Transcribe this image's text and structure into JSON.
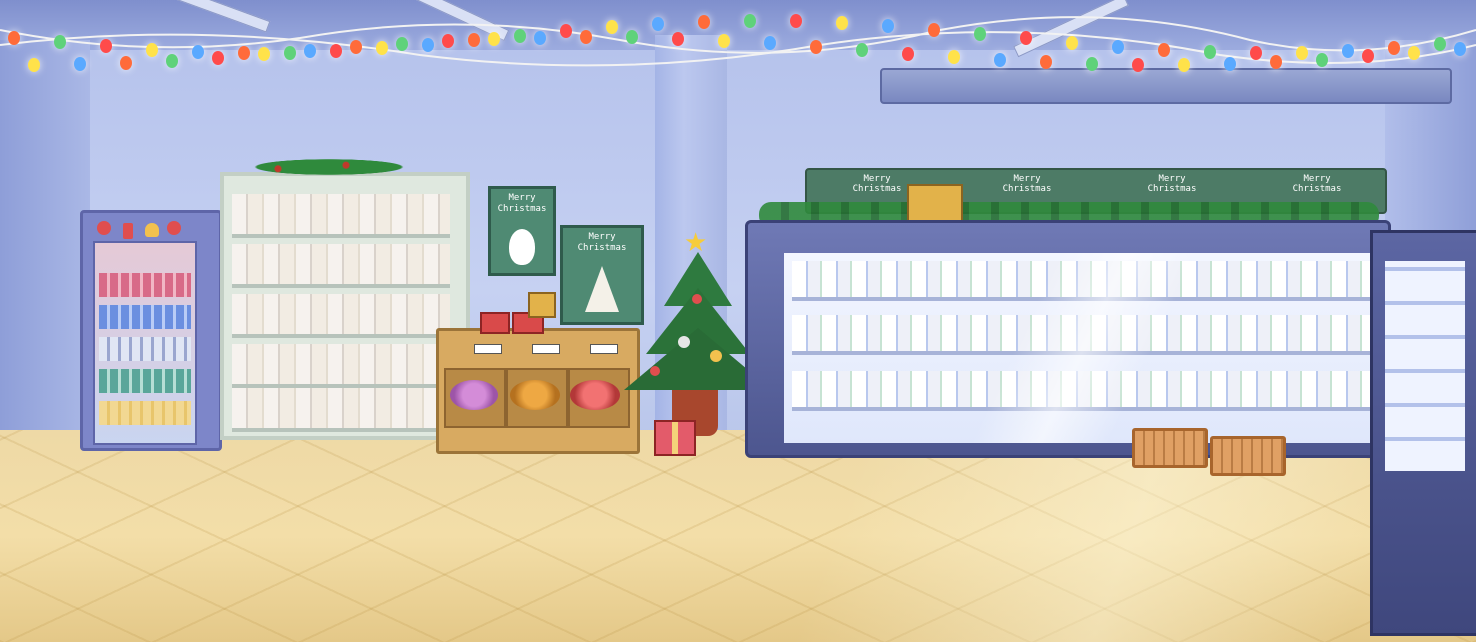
{
  "scene": "convenience store christmas",
  "posters": {
    "left": {
      "line1": "Merry",
      "line2": "Christmas"
    },
    "right": {
      "line1": "Merry",
      "line2": "Christmas"
    }
  },
  "banner": {
    "panels": [
      {
        "line1": "Merry",
        "line2": "Christmas"
      },
      {
        "line1": "Merry",
        "line2": "Christmas"
      },
      {
        "line1": "Merry",
        "line2": "Christmas"
      },
      {
        "line1": "Merry",
        "line2": "Christmas"
      }
    ]
  },
  "bin_labels": [
    "",
    "",
    ""
  ],
  "colors": {
    "wall": "#c2cdf0",
    "floor": "#f0d9a2",
    "poster": "#4f8a73",
    "fridge": "#7d86c9",
    "tree": "#2e7a3f"
  },
  "light_colors": [
    "#ff6b3a",
    "#ffe24a",
    "#5fd27a",
    "#5aa9ff",
    "#ff4b4b"
  ]
}
